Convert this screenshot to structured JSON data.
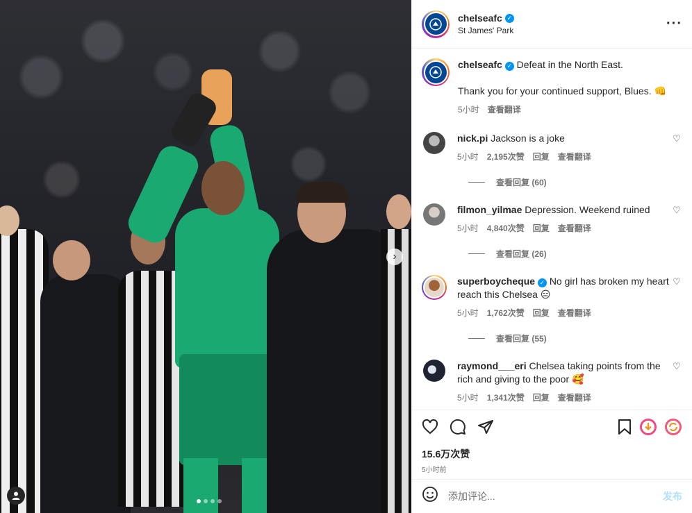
{
  "post": {
    "username": "chelseafc",
    "location": "St James' Park",
    "more_icon": "more-horizontal-icon",
    "caption_line1": "Defeat in the North East.",
    "caption_line2": "Thank you for your continued support, Blues. 👊",
    "caption_time": "5小时",
    "translate": "查看翻译",
    "likes": "15.6万次赞",
    "posted_ago": "5小时前",
    "add_comment_placeholder": "添加评论...",
    "post_button": "发布",
    "carousel_next_icon": "chevron-right-icon",
    "colors": {
      "verified": "#0095f6",
      "crest": "#034694",
      "kit": "#1aa971"
    }
  },
  "comments": [
    {
      "username": "nick.pi",
      "text": "Jackson is a joke",
      "time": "5小时",
      "likes": "2,195次赞",
      "reply": "回复",
      "translate": "查看翻译",
      "view_replies": "查看回复 (60)",
      "avatar_color": "#6d6d6d",
      "verified": false
    },
    {
      "username": "filmon_yilmae",
      "text": "Depression. Weekend ruined",
      "time": "5小时",
      "likes": "4,840次赞",
      "reply": "回复",
      "translate": "查看翻译",
      "view_replies": "查看回复 (26)",
      "avatar_color": "#8a8a8a",
      "verified": false
    },
    {
      "username": "superboycheque",
      "text": "No girl has broken my heart reach this Chelsea 😑",
      "time": "5小时",
      "likes": "1,762次赞",
      "reply": "回复",
      "translate": "查看翻译",
      "view_replies": "查看回复 (55)",
      "avatar_color": "#b07a56",
      "verified": true
    },
    {
      "username": "raymond___eri",
      "text": "Chelsea taking points from the rich and giving to the poor 🥰",
      "time": "5小时",
      "likes": "1,341次赞",
      "reply": "回复",
      "translate": "查看翻译",
      "avatar_color": "#3a4150",
      "verified": false
    }
  ]
}
